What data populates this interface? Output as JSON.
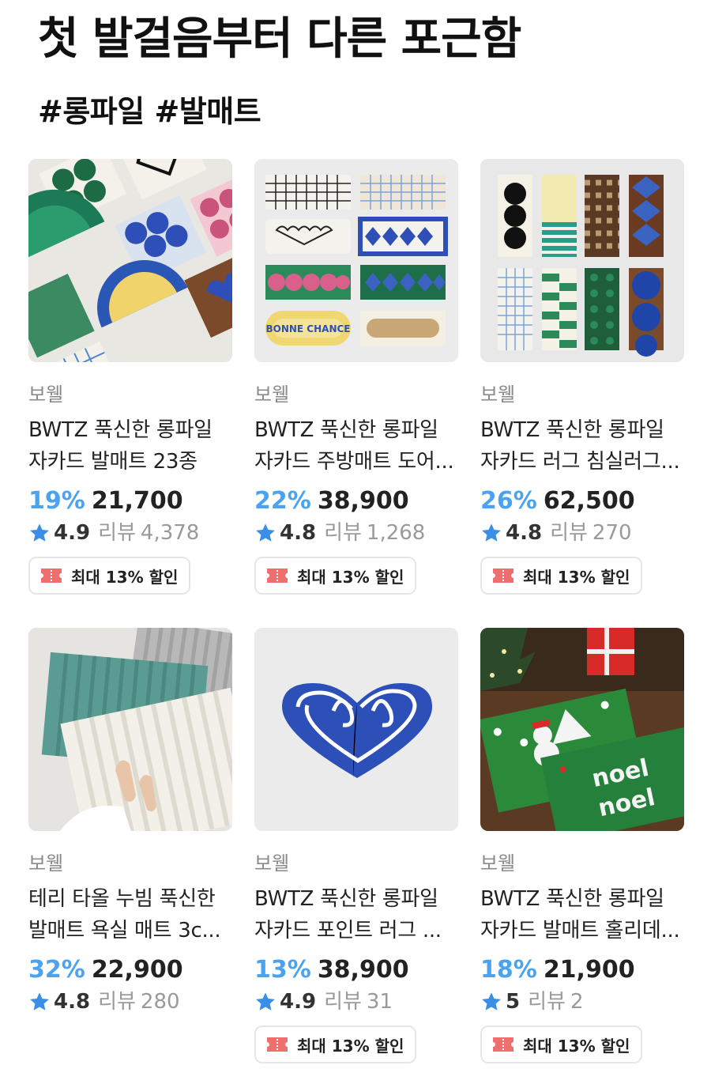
{
  "page": {
    "title": "첫 발걸음부터 다른 포근함",
    "tags": "#롱파일 #발매트"
  },
  "colors": {
    "discount": "#4aa3f0",
    "star": "#3a8ee6",
    "coupon_icon": "#ef6f6f"
  },
  "products": [
    {
      "brand": "보웰",
      "name_line1": "BWTZ 푹신한 롱파일",
      "name_line2": "자카드 발매트 23종",
      "discount": "19%",
      "price": "21,700",
      "rating": "4.9",
      "review_label": "리뷰",
      "review_count": "4,378",
      "coupon": "최대 13% 할인",
      "image_icon": "patterned-mats-photo"
    },
    {
      "brand": "보웰",
      "name_line1": "BWTZ 푹신한 롱파일",
      "name_line2": "자카드 주방매트 도어...",
      "discount": "22%",
      "price": "38,900",
      "rating": "4.8",
      "review_label": "리뷰",
      "review_count": "1,268",
      "coupon": "최대 13% 할인",
      "image_icon": "kitchen-mats-photo"
    },
    {
      "brand": "보웰",
      "name_line1": "BWTZ 푹신한 롱파일",
      "name_line2": "자카드 러그 침실러그...",
      "discount": "26%",
      "price": "62,500",
      "rating": "4.8",
      "review_label": "리뷰",
      "review_count": "270",
      "coupon": "최대 13% 할인",
      "image_icon": "runner-rugs-photo"
    },
    {
      "brand": "보웰",
      "name_line1": "테리 타올 누빔 푹신한",
      "name_line2": "발매트 욕실 매트 3c...",
      "discount": "32%",
      "price": "22,900",
      "rating": "4.8",
      "review_label": "리뷰",
      "review_count": "280",
      "coupon": "",
      "image_icon": "terry-bath-mats-photo"
    },
    {
      "brand": "보웰",
      "name_line1": "BWTZ 푹신한 롱파일",
      "name_line2": "자카드 포인트 러그 ...",
      "discount": "13%",
      "price": "38,900",
      "rating": "4.9",
      "review_label": "리뷰",
      "review_count": "31",
      "coupon": "최대 13% 할인",
      "image_icon": "double-heart-rug-photo"
    },
    {
      "brand": "보웰",
      "name_line1": "BWTZ 푹신한 롱파일",
      "name_line2": "자카드 발매트 홀리데...",
      "discount": "18%",
      "price": "21,900",
      "rating": "5",
      "review_label": "리뷰",
      "review_count": "2",
      "coupon": "최대 13% 할인",
      "image_icon": "holiday-mats-photo"
    }
  ]
}
